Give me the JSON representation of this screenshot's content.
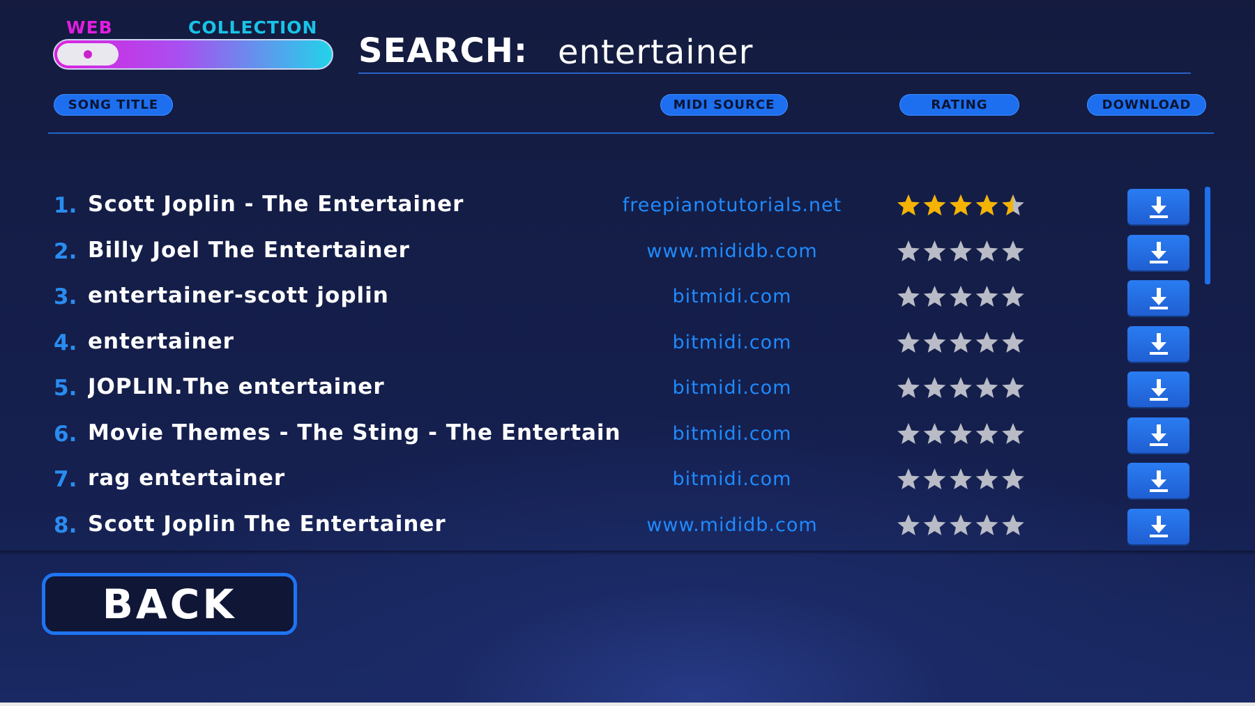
{
  "toggle": {
    "left_label": "WEB",
    "right_label": "COLLECTION",
    "selected": "WEB"
  },
  "search": {
    "label": "SEARCH:",
    "value": "entertainer"
  },
  "columns": {
    "song_title": "SONG TITLE",
    "midi_source": "MIDI SOURCE",
    "rating": "RATING",
    "download": "DOWNLOAD"
  },
  "results": [
    {
      "num": "1.",
      "title": "Scott Joplin - The Entertainer",
      "source": "freepianotutorials.net",
      "rating": 4.5
    },
    {
      "num": "2.",
      "title": "Billy Joel The Entertainer",
      "source": "www.mididb.com",
      "rating": 0
    },
    {
      "num": "3.",
      "title": "entertainer-scott joplin",
      "source": "bitmidi.com",
      "rating": 0
    },
    {
      "num": "4.",
      "title": "entertainer",
      "source": "bitmidi.com",
      "rating": 0
    },
    {
      "num": "5.",
      "title": "JOPLIN.The entertainer",
      "source": "bitmidi.com",
      "rating": 0
    },
    {
      "num": "6.",
      "title": "Movie Themes - The Sting - The Entertainer",
      "source": "bitmidi.com",
      "rating": 0
    },
    {
      "num": "7.",
      "title": "rag entertainer",
      "source": "bitmidi.com",
      "rating": 0
    },
    {
      "num": "8.",
      "title": "Scott Joplin The Entertainer",
      "source": "www.mididb.com",
      "rating": 0
    }
  ],
  "back_label": "BACK",
  "colors": {
    "star_filled": "#f5b301",
    "star_empty": "#b9bcc6",
    "accent": "#1f74f0"
  }
}
